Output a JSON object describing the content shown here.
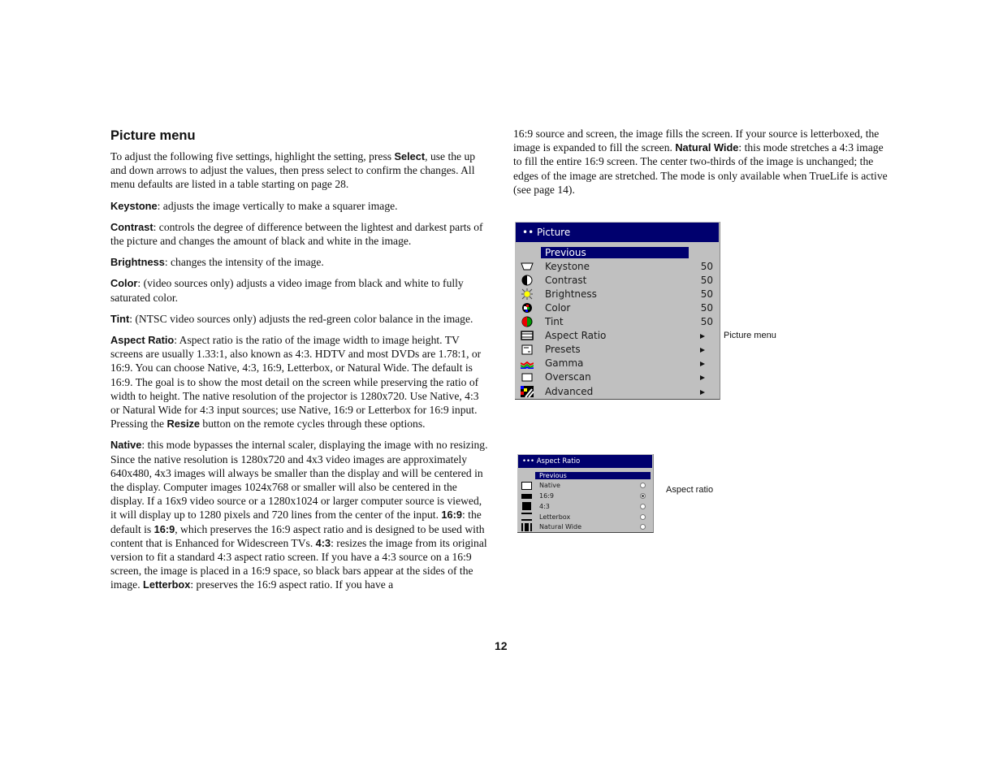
{
  "left": {
    "title": "Picture menu",
    "intro": [
      "To adjust the following five settings, highlight the setting, press ",
      "Select",
      ", use the up and down arrows to adjust the values, then press select to confirm the changes. All menu defaults are listed in a table starting on page 28."
    ],
    "keystone": [
      "Keystone",
      ": adjusts the image vertically to make a squarer image."
    ],
    "contrast": [
      "Contrast",
      ": controls the degree of difference between the lightest and darkest parts of the picture and changes the amount of black and white in the image."
    ],
    "brightness": [
      "Brightness",
      ": changes the intensity of the image."
    ],
    "color": [
      "Color",
      ": (video sources only) adjusts a video image from black and white to fully saturated color."
    ],
    "tint": [
      "Tint",
      ": (NTSC video sources only) adjusts the red-green color balance in the image."
    ],
    "aspect": [
      "Aspect Ratio",
      ": Aspect ratio is the ratio of the image width to image height. TV screens are usually 1.33:1, also known as 4:3. HDTV and most DVDs are 1.78:1, or 16:9. You can choose Native, 4:3, 16:9, Letterbox, or Natural Wide. The default is 16:9. The goal is to show the most detail on the screen while preserving the ratio of width to height. The native resolution of the projector is 1280x720. Use Native, 4:3 or Natural Wide for 4:3 input sources; use Native, 16:9 or Letterbox for 16:9 input. Pressing the ",
      "Resize",
      " button on the remote cycles through these options."
    ],
    "native": [
      "Native",
      ": this mode bypasses the internal scaler, displaying the image with no resizing. Since the native resolution is 1280x720 and 4x3 video images are approximately 640x480, 4x3 images will always be smaller than the display and will be centered in the display. Computer images 1024x768 or smaller will also be centered in the display. If a 16x9 video source or a 1280x1024 or larger computer source is viewed, it will display up to 1280 pixels and 720 lines from the center of the input. ",
      "16:9",
      ": the default is ",
      "16:9",
      ", which preserves the 16:9 aspect ratio and is designed to be used with content that is Enhanced for Widescreen TVs. ",
      "4:3",
      ": resizes the image from its original version to fit a standard 4:3 aspect ratio screen. If you have a 4:3 source on a 16:9 screen, the image is placed in a 16:9 space, so black bars appear at the sides of the image. ",
      "Letterbox",
      ": preserves the 16:9 aspect ratio. If you have a"
    ]
  },
  "right": {
    "cont": [
      "16:9 source and screen, the image fills the screen. If your source is letterboxed, the image is expanded to fill the screen. ",
      "Natural Wide",
      ": this mode stretches a 4:3 image to fill the entire 16:9 screen. The center two-thirds of the image is unchanged; the edges of the image are stretched. The mode is only available when TrueLife is active (see page 14)."
    ]
  },
  "page_number": "12",
  "picture_osd": {
    "title": "•• Picture",
    "items": [
      {
        "label": "Previous",
        "value": "",
        "icon": "none"
      },
      {
        "label": "Keystone",
        "value": "50",
        "icon": "keystone-icon"
      },
      {
        "label": "Contrast",
        "value": "50",
        "icon": "contrast-icon"
      },
      {
        "label": "Brightness",
        "value": "50",
        "icon": "brightness-icon"
      },
      {
        "label": "Color",
        "value": "50",
        "icon": "color-icon"
      },
      {
        "label": "Tint",
        "value": "50",
        "icon": "tint-icon"
      },
      {
        "label": "Aspect Ratio",
        "value": "►",
        "icon": "aspect-ratio-icon"
      },
      {
        "label": "Presets",
        "value": "►",
        "icon": "presets-icon"
      },
      {
        "label": "Gamma",
        "value": "►",
        "icon": "gamma-icon"
      },
      {
        "label": "Overscan",
        "value": "►",
        "icon": "overscan-icon"
      },
      {
        "label": "Advanced",
        "value": "►",
        "icon": "advanced-icon"
      }
    ],
    "caption": "Picture menu"
  },
  "aspect_osd": {
    "title": "••• Aspect Ratio",
    "items": [
      {
        "label": "Previous",
        "selected": false
      },
      {
        "label": "Native",
        "selected": false
      },
      {
        "label": "16:9",
        "selected": true
      },
      {
        "label": "4:3",
        "selected": false
      },
      {
        "label": "Letterbox",
        "selected": false
      },
      {
        "label": "Natural Wide",
        "selected": false
      }
    ],
    "caption": "Aspect ratio"
  },
  "colors": {
    "menu_header": "#00006e",
    "menu_bg": "#c0c0c0"
  }
}
